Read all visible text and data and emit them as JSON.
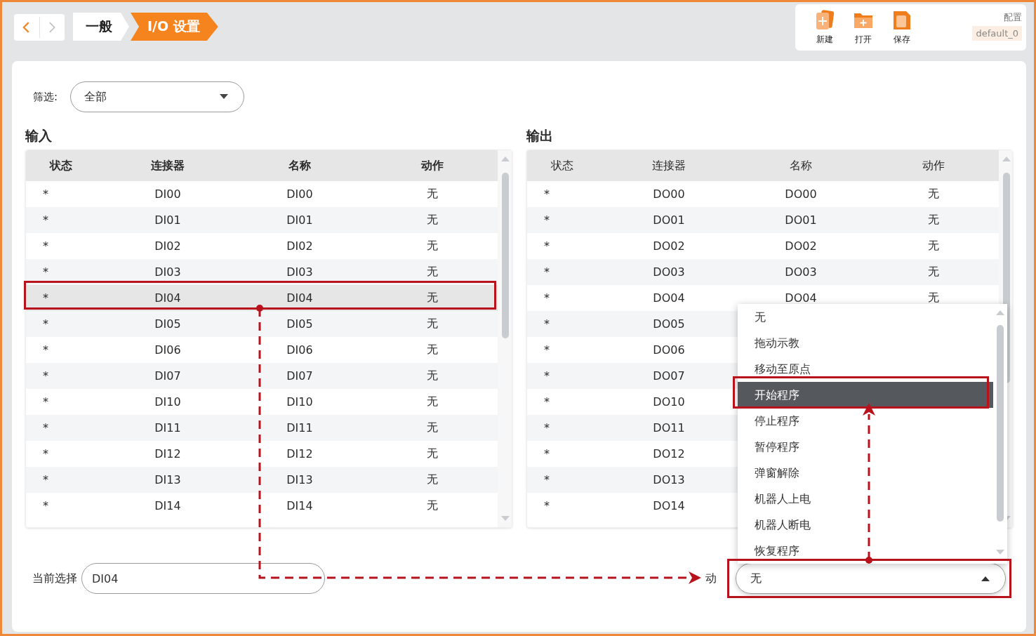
{
  "nav": {
    "back_disabled": false,
    "forward_disabled": true
  },
  "breadcrumb": [
    {
      "label": "一般",
      "selected": false
    },
    {
      "label": "I/O 设置",
      "selected": true
    }
  ],
  "toolbar": {
    "buttons": [
      {
        "label": "新建",
        "kind": "new"
      },
      {
        "label": "打开",
        "kind": "open"
      },
      {
        "label": "保存",
        "kind": "save"
      }
    ],
    "config_label": "配置",
    "config_value": "default_0"
  },
  "filter": {
    "label": "筛选:",
    "value": "全部"
  },
  "inputs": {
    "title": "输入",
    "columns": [
      "状态",
      "连接器",
      "名称",
      "动作"
    ],
    "rows": [
      {
        "status": "*",
        "connector": "DI00",
        "name": "DI00",
        "action": "无",
        "selected": false
      },
      {
        "status": "*",
        "connector": "DI01",
        "name": "DI01",
        "action": "无",
        "selected": false
      },
      {
        "status": "*",
        "connector": "DI02",
        "name": "DI02",
        "action": "无",
        "selected": false
      },
      {
        "status": "*",
        "connector": "DI03",
        "name": "DI03",
        "action": "无",
        "selected": false
      },
      {
        "status": "*",
        "connector": "DI04",
        "name": "DI04",
        "action": "无",
        "selected": true
      },
      {
        "status": "*",
        "connector": "DI05",
        "name": "DI05",
        "action": "无",
        "selected": false
      },
      {
        "status": "*",
        "connector": "DI06",
        "name": "DI06",
        "action": "无",
        "selected": false
      },
      {
        "status": "*",
        "connector": "DI07",
        "name": "DI07",
        "action": "无",
        "selected": false
      },
      {
        "status": "*",
        "connector": "DI10",
        "name": "DI10",
        "action": "无",
        "selected": false
      },
      {
        "status": "*",
        "connector": "DI11",
        "name": "DI11",
        "action": "无",
        "selected": false
      },
      {
        "status": "*",
        "connector": "DI12",
        "name": "DI12",
        "action": "无",
        "selected": false
      },
      {
        "status": "*",
        "connector": "DI13",
        "name": "DI13",
        "action": "无",
        "selected": false
      },
      {
        "status": "*",
        "connector": "DI14",
        "name": "DI14",
        "action": "无",
        "selected": false
      }
    ]
  },
  "outputs": {
    "title": "输出",
    "columns": [
      "状态",
      "连接器",
      "名称",
      "动作"
    ],
    "rows": [
      {
        "status": "*",
        "connector": "DO00",
        "name": "DO00",
        "action": "无",
        "selected": false
      },
      {
        "status": "*",
        "connector": "DO01",
        "name": "DO01",
        "action": "无",
        "selected": false
      },
      {
        "status": "*",
        "connector": "DO02",
        "name": "DO02",
        "action": "无",
        "selected": false
      },
      {
        "status": "*",
        "connector": "DO03",
        "name": "DO03",
        "action": "无",
        "selected": false
      },
      {
        "status": "*",
        "connector": "DO04",
        "name": "DO04",
        "action": "无",
        "selected": false
      },
      {
        "status": "*",
        "connector": "DO05",
        "selected": false
      },
      {
        "status": "*",
        "connector": "DO06",
        "selected": false
      },
      {
        "status": "*",
        "connector": "DO07",
        "selected": false
      },
      {
        "status": "*",
        "connector": "DO10",
        "selected": false
      },
      {
        "status": "*",
        "connector": "DO11",
        "selected": false
      },
      {
        "status": "*",
        "connector": "DO12",
        "selected": false
      },
      {
        "status": "*",
        "connector": "DO13",
        "selected": false
      },
      {
        "status": "*",
        "connector": "DO14",
        "selected": false
      }
    ]
  },
  "action_menu": {
    "items": [
      {
        "label": "无",
        "selected": false
      },
      {
        "label": "拖动示教",
        "selected": false
      },
      {
        "label": "移动至原点",
        "selected": false
      },
      {
        "label": "开始程序",
        "selected": true
      },
      {
        "label": "停止程序",
        "selected": false
      },
      {
        "label": "暂停程序",
        "selected": false
      },
      {
        "label": "弹窗解除",
        "selected": false
      },
      {
        "label": "机器人上电",
        "selected": false
      },
      {
        "label": "机器人断电",
        "selected": false
      },
      {
        "label": "恢复程序",
        "selected": false
      }
    ]
  },
  "current_selection": {
    "label": "当前选择",
    "value": "DI04"
  },
  "action_field": {
    "label": "动",
    "value": "无",
    "expanded": true
  }
}
